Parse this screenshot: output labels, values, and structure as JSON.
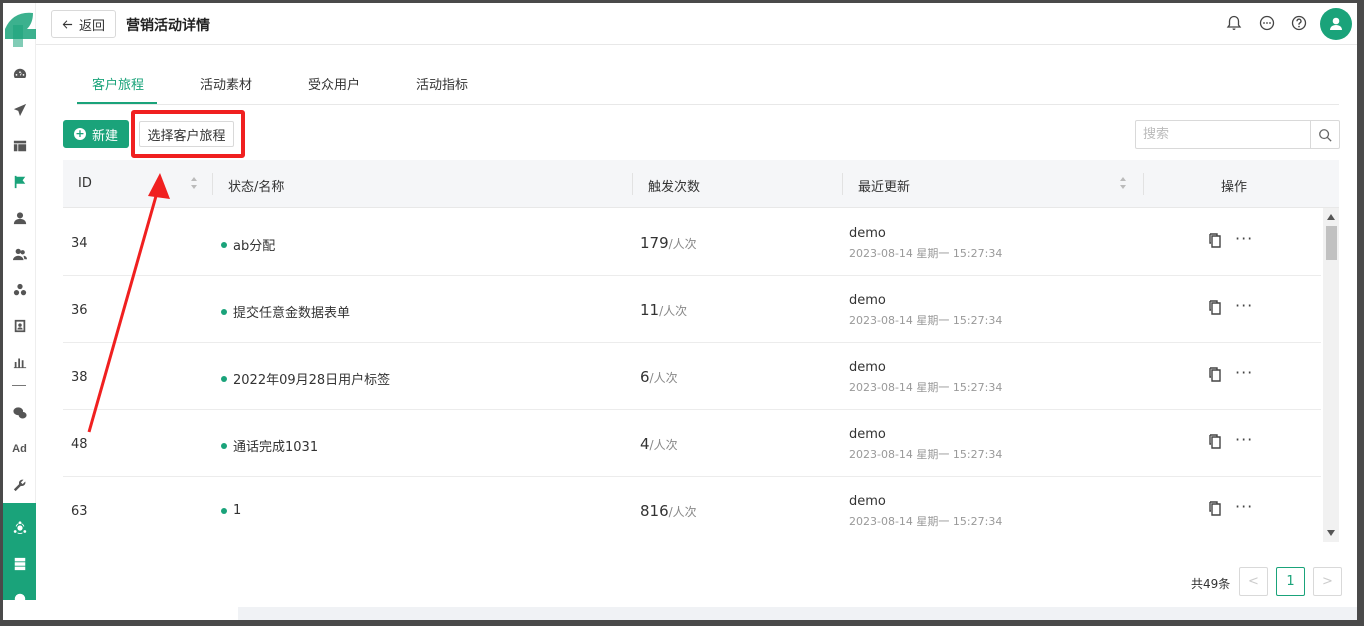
{
  "header": {
    "back_label": "返回",
    "title": "营销活动详情"
  },
  "tabs": [
    {
      "label": "客户旅程",
      "active": true
    },
    {
      "label": "活动素材",
      "active": false
    },
    {
      "label": "受众用户",
      "active": false
    },
    {
      "label": "活动指标",
      "active": false
    }
  ],
  "toolbar": {
    "new_label": "新建",
    "select_label": "选择客户旅程",
    "search_placeholder": "搜索"
  },
  "table": {
    "headers": {
      "id": "ID",
      "name": "状态/名称",
      "count": "触发次数",
      "updated": "最近更新",
      "actions": "操作"
    },
    "rows": [
      {
        "id": "34",
        "name": "ab分配",
        "count": "179",
        "unit": "/人次",
        "user": "demo",
        "time": "2023-08-14 星期一 15:27:34"
      },
      {
        "id": "36",
        "name": "提交任意金数据表单",
        "count": "11",
        "unit": "/人次",
        "user": "demo",
        "time": "2023-08-14 星期一 15:27:34"
      },
      {
        "id": "38",
        "name": "2022年09月28日用户标签",
        "count": "6",
        "unit": "/人次",
        "user": "demo",
        "time": "2023-08-14 星期一 15:27:34"
      },
      {
        "id": "48",
        "name": "通话完成1031",
        "count": "4",
        "unit": "/人次",
        "user": "demo",
        "time": "2023-08-14 星期一 15:27:34"
      },
      {
        "id": "63",
        "name": "1",
        "count": "816",
        "unit": "/人次",
        "user": "demo",
        "time": "2023-08-14 星期一 15:27:34"
      }
    ]
  },
  "pagination": {
    "total_label": "共49条",
    "current_page": "1",
    "prev": "<",
    "next": ">"
  },
  "sidebar": {
    "ad_label": "Ad"
  },
  "colors": {
    "accent": "#1aa37a",
    "highlight": "#f02020"
  }
}
